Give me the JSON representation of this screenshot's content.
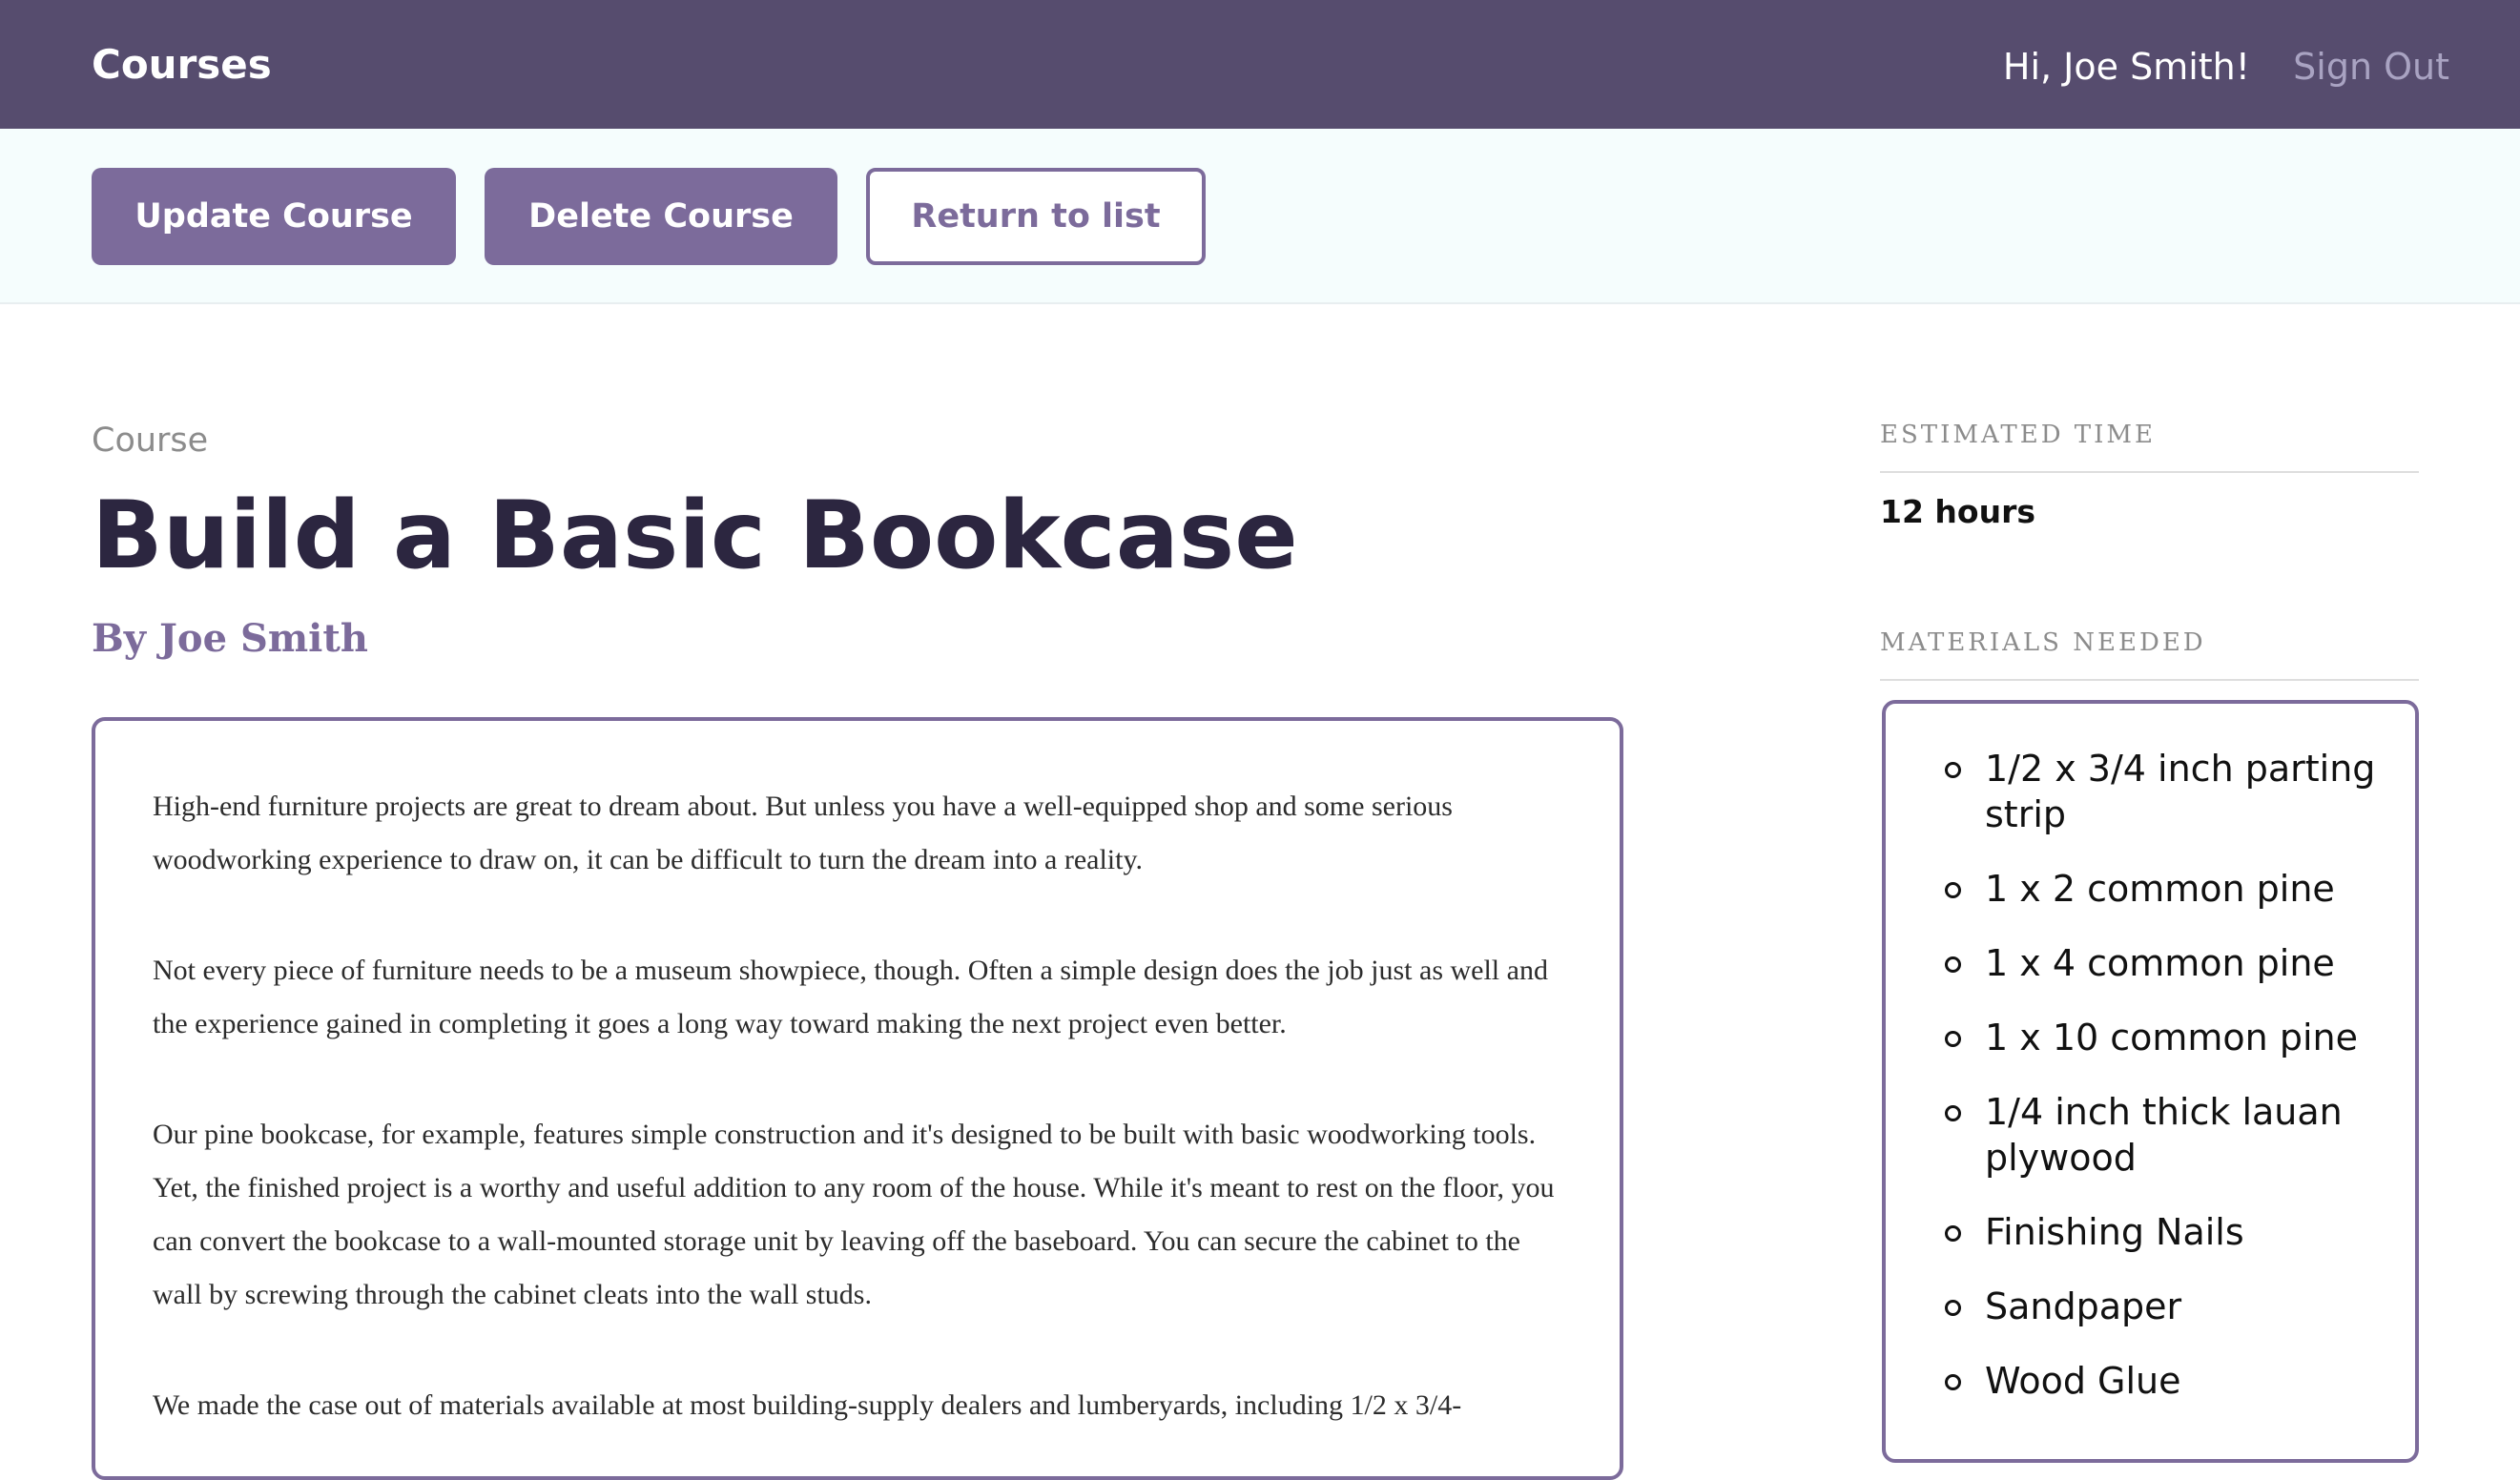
{
  "header": {
    "brand": "Courses",
    "greeting": "Hi, Joe Smith!",
    "sign_out": "Sign Out"
  },
  "actions": {
    "update": "Update Course",
    "delete": "Delete Course",
    "return": "Return to list"
  },
  "course": {
    "label": "Course",
    "title": "Build a Basic Bookcase",
    "author": "By Joe Smith",
    "description": [
      "High-end furniture projects are great to dream about. But unless you have a well-equipped shop and some serious woodworking experience to draw on, it can be difficult to turn the dream into a reality.",
      "Not every piece of furniture needs to be a museum showpiece, though. Often a simple design does the job just as well and the experience gained in completing it goes a long way toward making the next project even better.",
      "Our pine bookcase, for example, features simple construction and it's designed to be built with basic woodworking tools. Yet, the finished project is a worthy and useful addition to any room of the house. While it's meant to rest on the floor, you can convert the bookcase to a wall-mounted storage unit by leaving off the baseboard. You can secure the cabinet to the wall by screwing through the cabinet cleats into the wall studs.",
      "We made the case out of materials available at most building-supply dealers and lumberyards, including 1/2 x 3/4-"
    ]
  },
  "sidebar": {
    "time_heading": "ESTIMATED TIME",
    "time_value": "12 hours",
    "materials_heading": "MATERIALS NEEDED",
    "materials": [
      "1/2 x 3/4 inch parting strip",
      "1 x 2 common pine",
      "1 x 4 common pine",
      "1 x 10 common pine",
      "1/4 inch thick lauan plywood",
      "Finishing Nails",
      "Sandpaper",
      "Wood Glue"
    ]
  },
  "colors": {
    "header_bg": "#564c6e",
    "accent": "#7c6b9b",
    "title": "#2c2640",
    "actions_bg": "#f5fdfd"
  }
}
